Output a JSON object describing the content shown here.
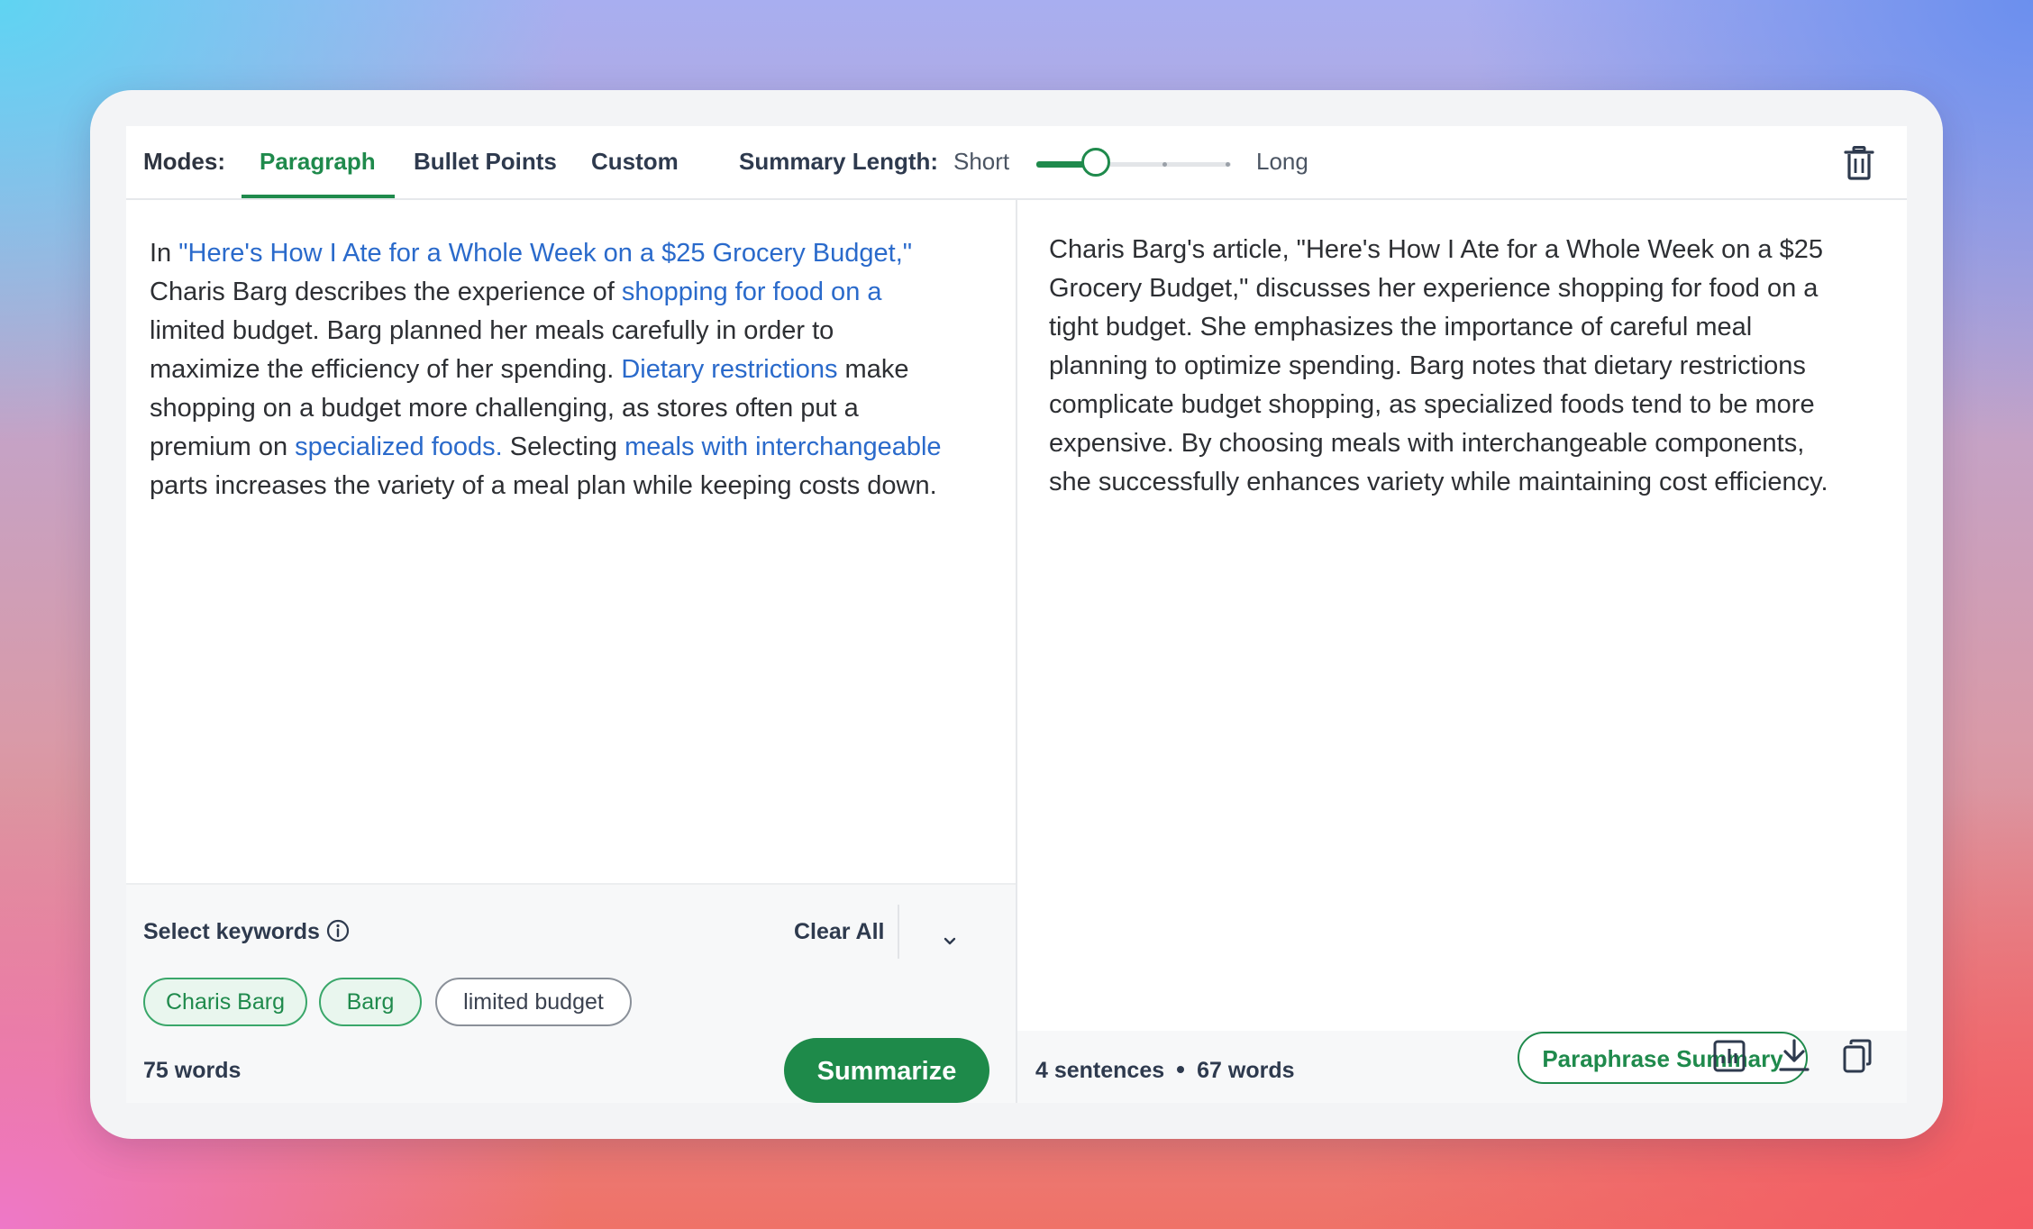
{
  "toolbar": {
    "modes_label": "Modes:",
    "tabs": [
      {
        "label": "Paragraph",
        "active": true
      },
      {
        "label": "Bullet Points",
        "active": false
      },
      {
        "label": "Custom",
        "active": false
      }
    ],
    "length_label": "Summary Length:",
    "length_short": "Short",
    "length_long": "Long",
    "length_level_fraction": 0.25
  },
  "input": {
    "segments": [
      {
        "text": "In ",
        "highlight": false
      },
      {
        "text": "\"Here's How I Ate for a Whole Week on a $25 Grocery Budget,\"",
        "highlight": true
      },
      {
        "text": " Charis Barg describes the experience of ",
        "highlight": false
      },
      {
        "text": "shopping for food on a",
        "highlight": true
      },
      {
        "text": " limited budget. Barg planned her meals carefully in order to maximize the efficiency of her spending. ",
        "highlight": false
      },
      {
        "text": "Dietary restrictions",
        "highlight": true
      },
      {
        "text": " make shopping on a budget more challenging, as stores often put a premium on ",
        "highlight": false
      },
      {
        "text": "specialized foods.",
        "highlight": true
      },
      {
        "text": " Selecting ",
        "highlight": false
      },
      {
        "text": "meals with interchangeable",
        "highlight": true
      },
      {
        "text": " parts increases the variety of a meal plan while keeping costs down.",
        "highlight": false
      }
    ],
    "word_count": "75 words"
  },
  "keywords": {
    "title": "Select keywords",
    "clear_all": "Clear All",
    "chips": [
      {
        "label": "Charis Barg",
        "selected": true
      },
      {
        "label": "Barg",
        "selected": true
      },
      {
        "label": "limited budget",
        "selected": false
      }
    ]
  },
  "actions": {
    "summarize": "Summarize",
    "paraphrase": "Paraphrase Summary"
  },
  "output": {
    "text": "Charis Barg's article, \"Here's How I Ate for a Whole Week on a $25 Grocery Budget,\" discusses her experience shopping for food on a tight budget. She emphasizes the importance of careful meal planning to optimize spending. Barg notes that dietary restrictions complicate budget shopping, as specialized foods tend to be more expensive. By choosing meals with interchangeable components, she successfully enhances variety while maintaining cost efficiency.",
    "sentences": "4 sentences",
    "words": "67 words"
  },
  "colors": {
    "accent": "#1f8a4c",
    "highlight": "#2a6acb"
  },
  "icons": [
    "trash-icon",
    "info-icon",
    "chevron-down-icon",
    "statistics-icon",
    "download-icon",
    "copy-icon"
  ]
}
